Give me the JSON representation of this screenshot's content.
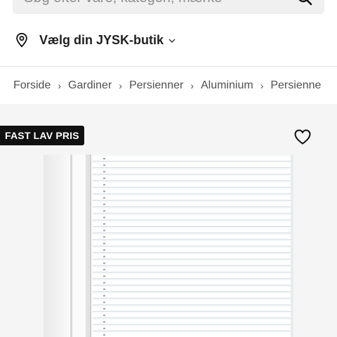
{
  "search": {
    "placeholder": "Søg efter vare, kategori, mærke"
  },
  "store": {
    "label": "Vælg din JYSK-butik"
  },
  "breadcrumb": [
    "Forside",
    "Gardiner",
    "Persienner",
    "Aluminium",
    "Persienne"
  ],
  "badge": {
    "text": "FAST LAV PRIS"
  },
  "icons": {
    "search": "search-icon",
    "location": "location-pin-icon",
    "chevron": "chevron-down-icon",
    "favorite": "heart-icon"
  }
}
